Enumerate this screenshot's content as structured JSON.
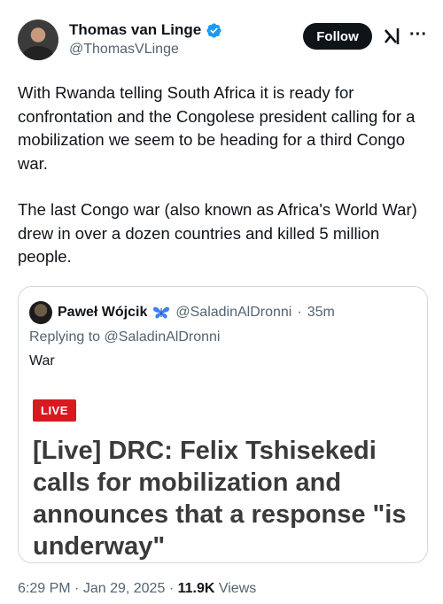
{
  "author": {
    "display_name": "Thomas van Linge",
    "handle": "@ThomasVLinge"
  },
  "actions": {
    "follow_label": "Follow",
    "more_label": "···"
  },
  "tweet": {
    "paragraphs": [
      "With Rwanda telling South Africa it is ready for confrontation and the Congolese president calling for a mobilization we seem to be heading for a third Congo war.",
      "The last Congo war (also known as Africa's World War) drew in over a dozen countries and killed 5 million people."
    ]
  },
  "quote": {
    "display_name": "Paweł Wójcik",
    "handle": "@SaladinAlDronni",
    "separator": "·",
    "time_ago": "35m",
    "reply_prefix": "Replying to ",
    "reply_handle": "@SaladinAlDronni",
    "text": "War",
    "media": {
      "badge": "LIVE",
      "headline": "[Live] DRC: Felix Tshisekedi calls for mobilization and announces that a response \"is underway\""
    }
  },
  "meta": {
    "time": "6:29 PM",
    "separator": "·",
    "date": "Jan 29, 2025",
    "views_count": "11.9K",
    "views_label": "Views"
  },
  "colors": {
    "primary_text": "#0f1419",
    "secondary_text": "#536471",
    "verified_blue": "#1d9bf0",
    "live_red": "#d71920",
    "border": "#cfd9de"
  }
}
